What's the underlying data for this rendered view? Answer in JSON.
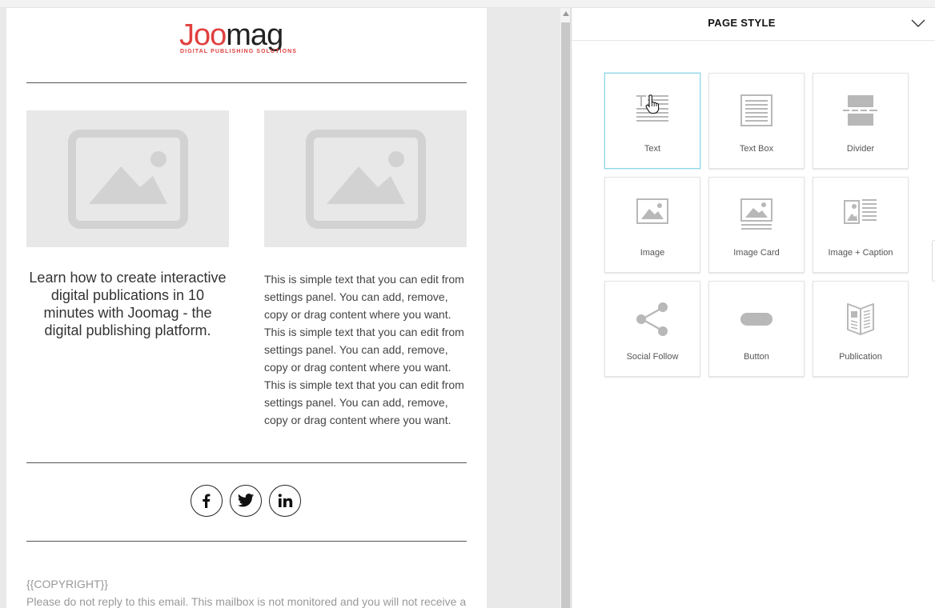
{
  "email": {
    "logo": {
      "word_red": "Joo",
      "word_dark": "mag",
      "tagline": "DIGITAL PUBLISHING SOLUTIONS"
    },
    "headline": "Learn how to create interactive digital publications in 10 minutes with Joomag - the digital publishing platform.",
    "body_text": "This is simple text that you can edit from settings panel. You can add, remove, copy or drag content where you want. This is simple text that you can edit from settings panel. You can add, remove, copy or drag content where you want. This is simple text that you can edit from settings panel. You can add, remove, copy or drag content where you want.",
    "social": [
      {
        "icon": "facebook-icon"
      },
      {
        "icon": "twitter-icon"
      },
      {
        "icon": "linkedin-icon"
      }
    ],
    "copyright": "{{COPYRIGHT}}",
    "disclaimer": "Please do not reply to this email. This mailbox is not monitored and you will not receive a"
  },
  "panel": {
    "title": "PAGE STYLE",
    "blocks": [
      {
        "label": "Text",
        "icon": "text-block-icon",
        "active": true
      },
      {
        "label": "Text Box",
        "icon": "text-box-icon"
      },
      {
        "label": "Divider",
        "icon": "divider-icon"
      },
      {
        "label": "Image",
        "icon": "image-icon"
      },
      {
        "label": "Image Card",
        "icon": "image-card-icon"
      },
      {
        "label": "Image + Caption",
        "icon": "image-caption-icon"
      },
      {
        "label": "Social Follow",
        "icon": "share-icon"
      },
      {
        "label": "Button",
        "icon": "button-icon"
      },
      {
        "label": "Publication",
        "icon": "publication-icon"
      }
    ]
  },
  "colors": {
    "brand_red": "#e0403f",
    "active_tile_border": "#8fd6e8",
    "icon_gray": "#b8b8b8"
  }
}
